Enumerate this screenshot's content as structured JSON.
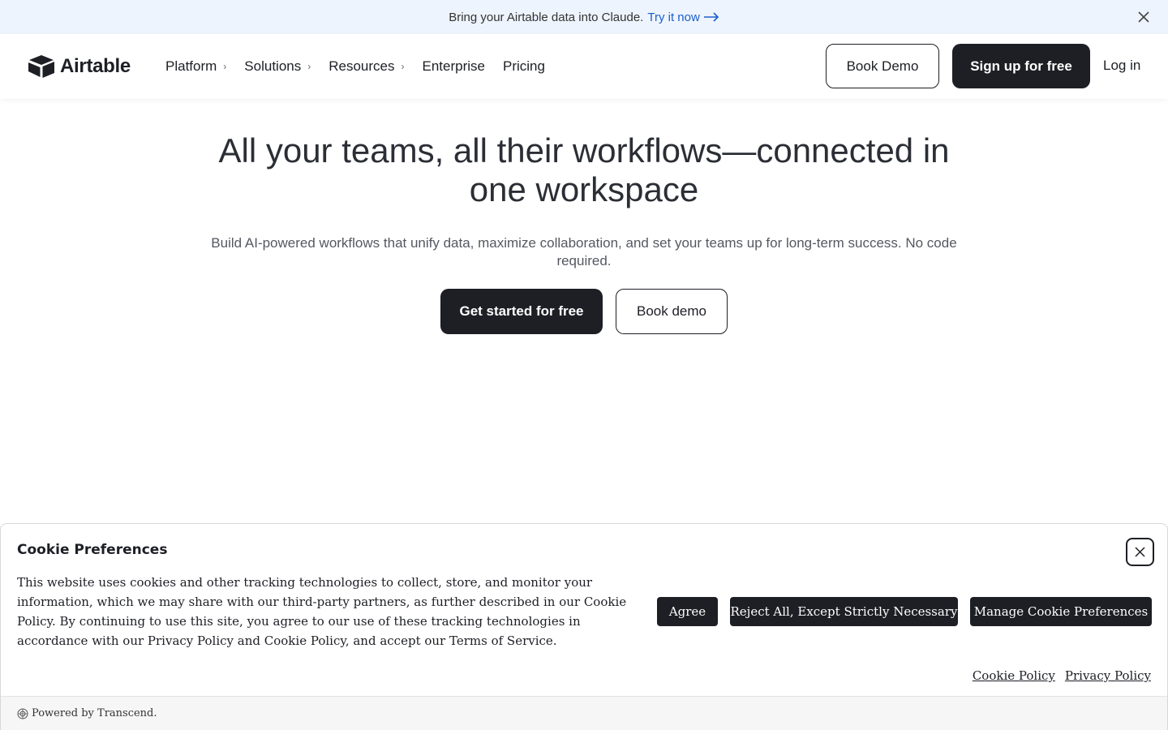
{
  "announcement": {
    "text": "Bring your Airtable data into Claude.",
    "link_label": "Try it now",
    "close_icon": "close-icon"
  },
  "header": {
    "logo_text": "Airtable",
    "nav": [
      {
        "label": "Platform",
        "has_chevron": true
      },
      {
        "label": "Solutions",
        "has_chevron": true
      },
      {
        "label": "Resources",
        "has_chevron": true
      },
      {
        "label": "Enterprise",
        "has_chevron": false
      },
      {
        "label": "Pricing",
        "has_chevron": false
      }
    ],
    "book_demo_label": "Book Demo",
    "signup_label": "Sign up for free",
    "login_label": "Log in"
  },
  "hero": {
    "title": "All your teams, all their workflows—connected in one workspace",
    "subtitle": "Build AI-powered workflows that unify data, maximize collaboration, and set your teams up for long-term success. No code required.",
    "primary_cta": "Get started for free",
    "secondary_cta": "Book demo"
  },
  "cookie": {
    "title": "Cookie Preferences",
    "body": "This website uses cookies and other tracking technologies to collect, store, and monitor your information, which we may share with our third-party partners, as further described in our Cookie Policy. By continuing to use this site, you agree to our use of these tracking technologies in accordance with our Privacy Policy and Cookie Policy, and accept our Terms of Service.",
    "agree_label": "Agree",
    "reject_label": "Reject All, Except Strictly Necessary",
    "manage_label": "Manage Cookie Preferences",
    "cookie_policy_link": "Cookie Policy",
    "privacy_policy_link": "Privacy Policy",
    "footer": "Powered by Transcend."
  },
  "colors": {
    "announce_bg": "#eef4fd",
    "link_blue": "#1a5fcc",
    "dark": "#1d1f25"
  }
}
